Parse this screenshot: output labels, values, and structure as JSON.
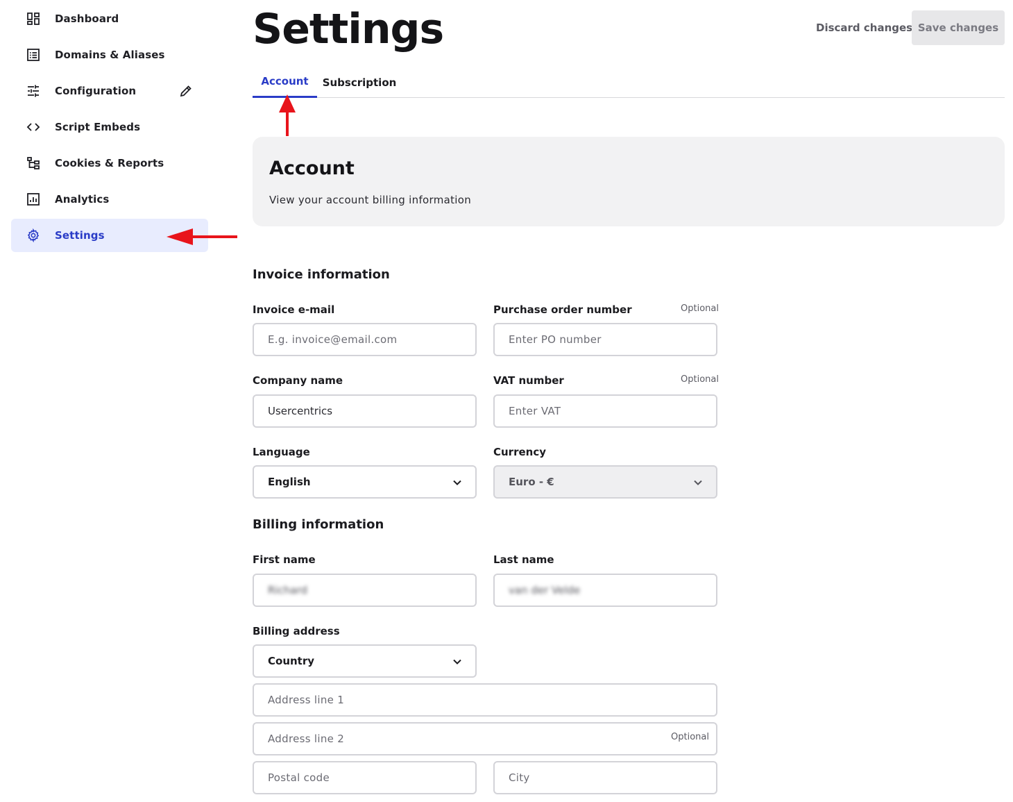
{
  "sidebar": {
    "items": [
      {
        "label": "Dashboard",
        "icon": "dashboard-icon"
      },
      {
        "label": "Domains & Aliases",
        "icon": "list-icon"
      },
      {
        "label": "Configuration",
        "icon": "sliders-icon"
      },
      {
        "label": "Script Embeds",
        "icon": "code-icon"
      },
      {
        "label": "Cookies & Reports",
        "icon": "tree-icon"
      },
      {
        "label": "Analytics",
        "icon": "chart-icon"
      },
      {
        "label": "Settings",
        "icon": "gear-icon",
        "active": true
      }
    ],
    "edit_icon": "pencil-icon"
  },
  "header": {
    "title": "Settings",
    "discard_label": "Discard changes",
    "save_label": "Save changes"
  },
  "tabs": [
    {
      "label": "Account",
      "active": true
    },
    {
      "label": "Subscription",
      "active": false
    }
  ],
  "account_card": {
    "title": "Account",
    "description": "View your account billing information"
  },
  "invoice": {
    "title": "Invoice information",
    "email_label": "Invoice e-mail",
    "email_placeholder": "E.g. invoice@email.com",
    "po_label": "Purchase order number",
    "po_optional": "Optional",
    "po_placeholder": "Enter PO number",
    "company_label": "Company name",
    "company_value": "Usercentrics",
    "vat_label": "VAT number",
    "vat_optional": "Optional",
    "vat_placeholder": "Enter VAT",
    "language_label": "Language",
    "language_value": "English",
    "currency_label": "Currency",
    "currency_value": "Euro - €"
  },
  "billing": {
    "title": "Billing information",
    "first_name_label": "First name",
    "first_name_value": "Richard",
    "last_name_label": "Last name",
    "last_name_value": "van der Velde",
    "address_label": "Billing address",
    "country_value": "Country",
    "address1_placeholder": "Address line 1",
    "address2_placeholder": "Address line 2",
    "address2_optional": "Optional",
    "postal_placeholder": "Postal code",
    "city_placeholder": "City"
  },
  "colors": {
    "accent": "#2a3cc7",
    "active_bg": "#e8ecfe",
    "annotation": "#e8141b"
  }
}
